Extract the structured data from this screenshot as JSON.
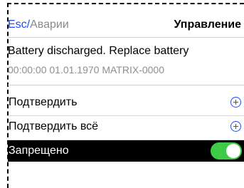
{
  "header": {
    "back_label": "Esc",
    "separator": "/",
    "current_label": "Аварии",
    "section_title": "Управление"
  },
  "alarm": {
    "message": "Battery discharged. Replace battery",
    "meta": "00:00:00 01.01.1970 MATRIX-0000"
  },
  "actions": [
    {
      "label": "Подтвердить",
      "icon": "plus-circle-icon"
    },
    {
      "label": "Подтвердить всё",
      "icon": "plus-circle-icon"
    }
  ],
  "toggle_row": {
    "label": "Запрещено",
    "state": "on"
  },
  "colors": {
    "accent": "#1e4bf5",
    "toggle_on": "#3ecb47",
    "muted_text": "#8f8f8f",
    "selected_row_bg": "#000000"
  }
}
